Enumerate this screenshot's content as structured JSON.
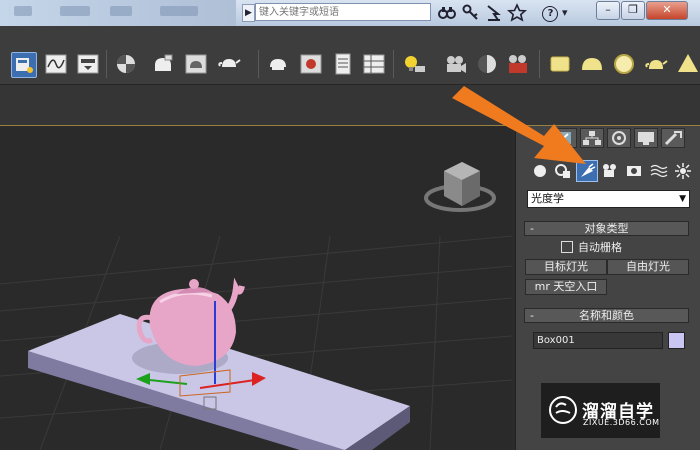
{
  "search": {
    "placeholder": "键入关键字或短语"
  },
  "titlebar": {
    "dropdown_arrow": "▶",
    "help_label": "?",
    "help_dropdown": "▾",
    "minimize": "–",
    "restore": "❐",
    "close": "✕"
  },
  "command_panel": {
    "light_type_value": "光度学",
    "object_type": {
      "header": "对象类型",
      "collapse_symbol": "-",
      "autogrid_label": "自动栅格",
      "buttons": [
        "目标灯光",
        "自由灯光",
        "mr 天空入口"
      ]
    },
    "name_color": {
      "header": "名称和颜色",
      "collapse_symbol": "-",
      "name_value": "Box001",
      "swatch_color": "#c9c6f3"
    }
  },
  "watermark": {
    "brand": "溜溜自学",
    "url": "ZIXUE.3D66.COM"
  },
  "colors": {
    "annotation_arrow": "#f07a1e",
    "teapot": "#e7a6c8",
    "box": "#c9c6e6",
    "active_tab": "#3d6fb0"
  }
}
